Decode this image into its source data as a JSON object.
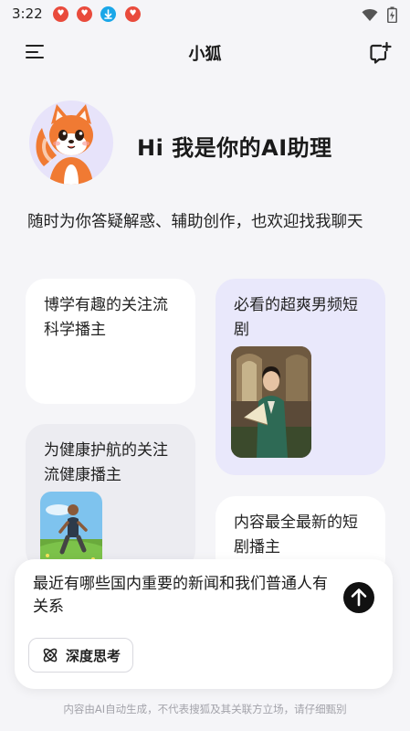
{
  "status_bar": {
    "time": "3:22",
    "notification_icons": [
      "fox-app-icon",
      "fox-app-icon",
      "download-icon",
      "fox-app-icon"
    ],
    "system_icons": [
      "wifi-icon",
      "battery-icon"
    ]
  },
  "app_bar": {
    "title": "小狐",
    "left_icon": "menu-icon",
    "right_icon": "new-chat-icon"
  },
  "hero": {
    "greeting": "Hi 我是你的AI助理",
    "intro": "随时为你答疑解惑、辅助创作，也欢迎找我聊天"
  },
  "suggestions": [
    {
      "text": "博学有趣的关注流科学播主"
    },
    {
      "text": "必看的超爽男频短剧",
      "image": "drama-poster"
    },
    {
      "text": "为健康护航的关注流健康播主",
      "image": "runner-photo"
    },
    {
      "text": "内容最全最新的短剧播主"
    }
  ],
  "composer": {
    "input_value": "最近有哪些国内重要的新闻和我们普通人有关系",
    "deep_think_label": "深度思考",
    "send_icon": "arrow-up-icon"
  },
  "footer": {
    "disclaimer": "内容由AI自动生成，不代表搜狐及其关联方立场，请仔细甄别"
  },
  "colors": {
    "background": "#f5f5f8",
    "card_white": "#ffffff",
    "card_lavender": "#e9e8fb",
    "card_gray": "#ececf1",
    "fox_orange": "#f07a33"
  }
}
